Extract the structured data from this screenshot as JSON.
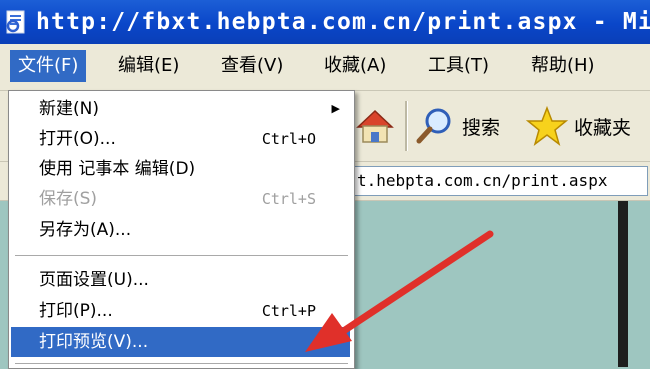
{
  "titlebar": {
    "title": "http://fbxt.hebpta.com.cn/print.aspx - Micr"
  },
  "menubar": {
    "items": [
      {
        "label": "文件(F)"
      },
      {
        "label": "编辑(E)"
      },
      {
        "label": "查看(V)"
      },
      {
        "label": "收藏(A)"
      },
      {
        "label": "工具(T)"
      },
      {
        "label": "帮助(H)"
      }
    ]
  },
  "toolbar": {
    "search_label": "搜索",
    "favorites_label": "收藏夹"
  },
  "address": {
    "value": "t.hebpta.com.cn/print.aspx"
  },
  "file_menu": {
    "items": [
      {
        "label": "新建(N)",
        "shortcut": "",
        "submenu": true
      },
      {
        "label": "打开(O)...",
        "shortcut": "Ctrl+O"
      },
      {
        "label": "使用 记事本 编辑(D)",
        "shortcut": ""
      },
      {
        "label": "保存(S)",
        "shortcut": "Ctrl+S",
        "disabled": true
      },
      {
        "label": "另存为(A)...",
        "shortcut": ""
      },
      {
        "label": "页面设置(U)...",
        "shortcut": ""
      },
      {
        "label": "打印(P)...",
        "shortcut": "Ctrl+P"
      },
      {
        "label": "打印预览(V)...",
        "shortcut": "",
        "highlighted": true
      }
    ],
    "submenu_arrow": "▶"
  },
  "colors": {
    "titlebar": "#0a46c9",
    "highlight": "#316ac5",
    "annotation_arrow": "#e0302a",
    "menu_bg": "#ece9d8"
  }
}
